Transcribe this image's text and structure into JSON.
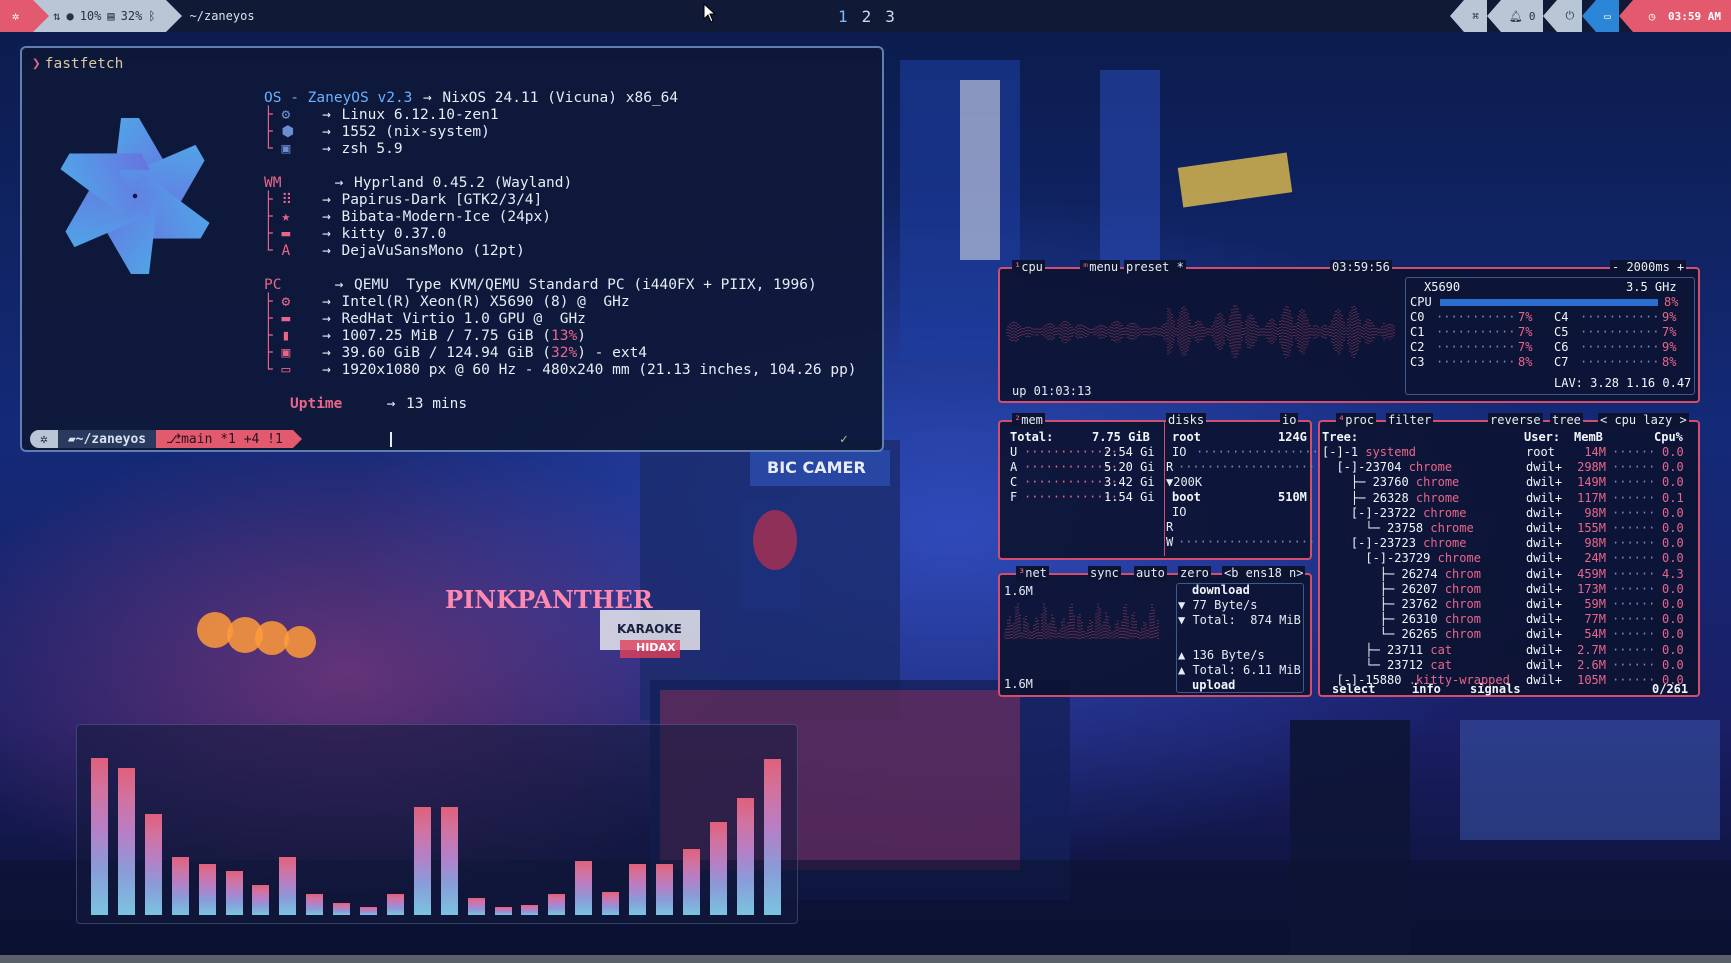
{
  "topbar": {
    "cpu_label": "10%",
    "mem_label": "32%",
    "path": "~/zaneyos",
    "workspaces": [
      "1",
      "2",
      "3"
    ],
    "active_workspace": "1",
    "notif_count": "0",
    "clock": "03:59 AM"
  },
  "terminal": {
    "prompt_symbol": "❯",
    "command": "fastfetch",
    "os_header_key": "OS - ZaneyOS v2.3",
    "os_value": "NixOS 24.11 (Vicuna) x86_64",
    "kernel": "Linux 6.12.10-zen1",
    "packages": "1552 (nix-system)",
    "shell": "zsh 5.9",
    "wm_key": "WM",
    "wm": "Hyprland 0.45.2 (Wayland)",
    "theme": "Papirus-Dark [GTK2/3/4]",
    "cursor": "Bibata-Modern-Ice (24px)",
    "terminal": "kitty 0.37.0",
    "font": "DejaVuSansMono (12pt)",
    "pc_key": "PC",
    "host": "QEMU  Type KVM/QEMU Standard PC (i440FX + PIIX, 1996)",
    "cpu": "Intel(R) Xeon(R) X5690 (8) @  GHz",
    "gpu": "RedHat Virtio 1.0 GPU @  GHz",
    "memory_a": "1007.25 MiB / 7.75 GiB (",
    "memory_pct": "13%",
    "memory_b": ")",
    "disk_a": "39.60 GiB / 124.94 GiB (",
    "disk_pct": "32%",
    "disk_b": ") - ext4",
    "display": "1920x1080 px @ 60 Hz - 480x240 mm (21.13 inches, 104.26 pp)",
    "uptime_key": "Uptime",
    "uptime": "13 mins",
    "arrow": "→",
    "pl_dir": "~/zaneyos",
    "pl_git": "main *1 +4 !1",
    "check": "✓"
  },
  "btop": {
    "cpu_tab": "cpu",
    "menu_tab": "menu",
    "preset_tab": "preset *",
    "time": "03:59:56",
    "interval": "- 2000ms +",
    "cpu_model": "X5690",
    "cpu_freq": "3.5 GHz",
    "cpu_total_label": "CPU",
    "cpu_total_pct": "8%",
    "cores": [
      {
        "name": "C0",
        "pct": "7%"
      },
      {
        "name": "C1",
        "pct": "7%"
      },
      {
        "name": "C2",
        "pct": "7%"
      },
      {
        "name": "C3",
        "pct": "8%"
      },
      {
        "name": "C4",
        "pct": "9%"
      },
      {
        "name": "C5",
        "pct": "7%"
      },
      {
        "name": "C6",
        "pct": "9%"
      },
      {
        "name": "C7",
        "pct": "8%"
      }
    ],
    "lav": "LAV: 3.28 1.16 0.47",
    "uptime": "up 01:03:13",
    "mem_tab": "mem",
    "disks_tab": "disks",
    "io_tab": "io",
    "mem_total_label": "Total:",
    "mem_total": "7.75 GiB",
    "mem_rows": [
      {
        "k": "U",
        "v": "2.54 Gi"
      },
      {
        "k": "A",
        "v": "5.20 Gi"
      },
      {
        "k": "C",
        "v": "3.42 Gi"
      },
      {
        "k": "F",
        "v": "1.54 Gi"
      }
    ],
    "disk_root": "root",
    "disk_root_size": "124G",
    "disk_io": "IO",
    "disk_r": "R",
    "disk_speed": "▼200K",
    "disk_boot": "boot",
    "disk_boot_size": "510M",
    "disk_w": "W",
    "net_tab": "net",
    "sync_tab": "sync",
    "auto_tab": "auto",
    "zero_tab": "zero",
    "iface": "<b ens18 n>",
    "net_top": "1.6M",
    "net_bottom": "1.6M",
    "download_label": "download",
    "down_rate": "▼ 77 Byte/s",
    "down_total": "▼ Total:  874 MiB",
    "up_rate": "▲ 136 Byte/s",
    "up_total": "▲ Total: 6.11 MiB",
    "upload_label": "upload",
    "proc_tab": "proc",
    "filter_tab": "filter",
    "reverse_tab": "reverse",
    "tree_tab": "tree",
    "cpu_lazy": "< cpu lazy >",
    "proc_header": {
      "tree": "Tree:",
      "user": "User:",
      "mem": "MemB",
      "cpu": "Cpu%"
    },
    "procs": [
      {
        "tree": "[-]-1 ",
        "name": "systemd",
        "user": "root",
        "mem": "14M",
        "cpu": "0.0"
      },
      {
        "tree": "  [-]-23704 ",
        "name": "chrome",
        "user": "dwil+",
        "mem": "298M",
        "cpu": "0.0"
      },
      {
        "tree": "    ├─ 23760 ",
        "name": "chrome",
        "user": "dwil+",
        "mem": "149M",
        "cpu": "0.0"
      },
      {
        "tree": "    ├─ 26328 ",
        "name": "chrome",
        "user": "dwil+",
        "mem": "117M",
        "cpu": "0.1"
      },
      {
        "tree": "    [-]-23722 ",
        "name": "chrome",
        "user": "dwil+",
        "mem": "98M",
        "cpu": "0.0"
      },
      {
        "tree": "      └─ 23758 ",
        "name": "chrome",
        "user": "dwil+",
        "mem": "155M",
        "cpu": "0.0"
      },
      {
        "tree": "    [-]-23723 ",
        "name": "chrome",
        "user": "dwil+",
        "mem": "98M",
        "cpu": "0.0"
      },
      {
        "tree": "      [-]-23729 ",
        "name": "chrome",
        "user": "dwil+",
        "mem": "24M",
        "cpu": "0.0"
      },
      {
        "tree": "        ├─ 26274 ",
        "name": "chrom",
        "user": "dwil+",
        "mem": "459M",
        "cpu": "4.3"
      },
      {
        "tree": "        ├─ 26207 ",
        "name": "chrom",
        "user": "dwil+",
        "mem": "173M",
        "cpu": "0.0"
      },
      {
        "tree": "        ├─ 23762 ",
        "name": "chrom",
        "user": "dwil+",
        "mem": "59M",
        "cpu": "0.0"
      },
      {
        "tree": "        ├─ 26310 ",
        "name": "chrom",
        "user": "dwil+",
        "mem": "77M",
        "cpu": "0.0"
      },
      {
        "tree": "        └─ 26265 ",
        "name": "chrom",
        "user": "dwil+",
        "mem": "54M",
        "cpu": "0.0"
      },
      {
        "tree": "      ├─ 23711 ",
        "name": "cat",
        "user": "dwil+",
        "mem": "2.7M",
        "cpu": "0.0"
      },
      {
        "tree": "      └─ 23712 ",
        "name": "cat",
        "user": "dwil+",
        "mem": "2.6M",
        "cpu": "0.0"
      },
      {
        "tree": "  [-]-15880 ",
        "name": ".kitty-wrapped",
        "user": "dwil+",
        "mem": "105M",
        "cpu": "0.0"
      }
    ],
    "select": "select",
    "info": "info",
    "signals": "signals",
    "count": "0/261"
  },
  "wallpaper": {
    "sign1": "BIC CAMER",
    "sign2": "PINKPANTHER",
    "sign3": "KARAOKE",
    "sign4": "HIDAX"
  },
  "visualizer": {
    "levels": [
      0.9,
      0.84,
      0.58,
      0.33,
      0.29,
      0.25,
      0.17,
      0.33,
      0.12,
      0.07,
      0.04,
      0.12,
      0.62,
      0.62,
      0.1,
      0.03,
      0.06,
      0.12,
      0.31,
      0.13,
      0.29,
      0.29,
      0.38,
      0.53,
      0.67,
      0.89
    ]
  },
  "colors": {
    "accent_red": "#e35a6e",
    "accent_blue": "#6bb0ff",
    "panel_border": "#d24e6c",
    "terminal_border": "#5e7fb0"
  }
}
